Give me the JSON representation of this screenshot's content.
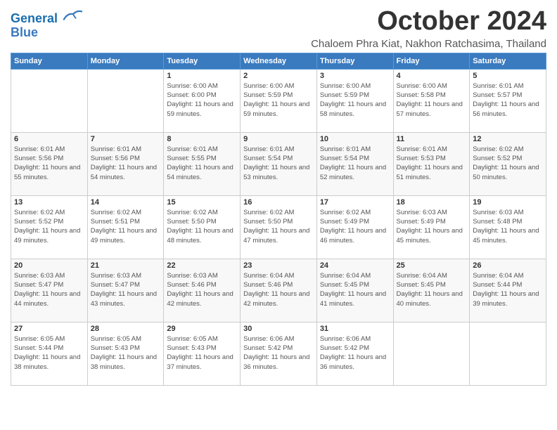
{
  "logo": {
    "line1": "General",
    "line2": "Blue"
  },
  "title": "October 2024",
  "subtitle": "Chaloem Phra Kiat, Nakhon Ratchasima, Thailand",
  "weekdays": [
    "Sunday",
    "Monday",
    "Tuesday",
    "Wednesday",
    "Thursday",
    "Friday",
    "Saturday"
  ],
  "weeks": [
    [
      {
        "day": "",
        "info": ""
      },
      {
        "day": "",
        "info": ""
      },
      {
        "day": "1",
        "info": "Sunrise: 6:00 AM\nSunset: 6:00 PM\nDaylight: 11 hours and 59 minutes."
      },
      {
        "day": "2",
        "info": "Sunrise: 6:00 AM\nSunset: 5:59 PM\nDaylight: 11 hours and 59 minutes."
      },
      {
        "day": "3",
        "info": "Sunrise: 6:00 AM\nSunset: 5:59 PM\nDaylight: 11 hours and 58 minutes."
      },
      {
        "day": "4",
        "info": "Sunrise: 6:00 AM\nSunset: 5:58 PM\nDaylight: 11 hours and 57 minutes."
      },
      {
        "day": "5",
        "info": "Sunrise: 6:01 AM\nSunset: 5:57 PM\nDaylight: 11 hours and 56 minutes."
      }
    ],
    [
      {
        "day": "6",
        "info": "Sunrise: 6:01 AM\nSunset: 5:56 PM\nDaylight: 11 hours and 55 minutes."
      },
      {
        "day": "7",
        "info": "Sunrise: 6:01 AM\nSunset: 5:56 PM\nDaylight: 11 hours and 54 minutes."
      },
      {
        "day": "8",
        "info": "Sunrise: 6:01 AM\nSunset: 5:55 PM\nDaylight: 11 hours and 54 minutes."
      },
      {
        "day": "9",
        "info": "Sunrise: 6:01 AM\nSunset: 5:54 PM\nDaylight: 11 hours and 53 minutes."
      },
      {
        "day": "10",
        "info": "Sunrise: 6:01 AM\nSunset: 5:54 PM\nDaylight: 11 hours and 52 minutes."
      },
      {
        "day": "11",
        "info": "Sunrise: 6:01 AM\nSunset: 5:53 PM\nDaylight: 11 hours and 51 minutes."
      },
      {
        "day": "12",
        "info": "Sunrise: 6:02 AM\nSunset: 5:52 PM\nDaylight: 11 hours and 50 minutes."
      }
    ],
    [
      {
        "day": "13",
        "info": "Sunrise: 6:02 AM\nSunset: 5:52 PM\nDaylight: 11 hours and 49 minutes."
      },
      {
        "day": "14",
        "info": "Sunrise: 6:02 AM\nSunset: 5:51 PM\nDaylight: 11 hours and 49 minutes."
      },
      {
        "day": "15",
        "info": "Sunrise: 6:02 AM\nSunset: 5:50 PM\nDaylight: 11 hours and 48 minutes."
      },
      {
        "day": "16",
        "info": "Sunrise: 6:02 AM\nSunset: 5:50 PM\nDaylight: 11 hours and 47 minutes."
      },
      {
        "day": "17",
        "info": "Sunrise: 6:02 AM\nSunset: 5:49 PM\nDaylight: 11 hours and 46 minutes."
      },
      {
        "day": "18",
        "info": "Sunrise: 6:03 AM\nSunset: 5:49 PM\nDaylight: 11 hours and 45 minutes."
      },
      {
        "day": "19",
        "info": "Sunrise: 6:03 AM\nSunset: 5:48 PM\nDaylight: 11 hours and 45 minutes."
      }
    ],
    [
      {
        "day": "20",
        "info": "Sunrise: 6:03 AM\nSunset: 5:47 PM\nDaylight: 11 hours and 44 minutes."
      },
      {
        "day": "21",
        "info": "Sunrise: 6:03 AM\nSunset: 5:47 PM\nDaylight: 11 hours and 43 minutes."
      },
      {
        "day": "22",
        "info": "Sunrise: 6:03 AM\nSunset: 5:46 PM\nDaylight: 11 hours and 42 minutes."
      },
      {
        "day": "23",
        "info": "Sunrise: 6:04 AM\nSunset: 5:46 PM\nDaylight: 11 hours and 42 minutes."
      },
      {
        "day": "24",
        "info": "Sunrise: 6:04 AM\nSunset: 5:45 PM\nDaylight: 11 hours and 41 minutes."
      },
      {
        "day": "25",
        "info": "Sunrise: 6:04 AM\nSunset: 5:45 PM\nDaylight: 11 hours and 40 minutes."
      },
      {
        "day": "26",
        "info": "Sunrise: 6:04 AM\nSunset: 5:44 PM\nDaylight: 11 hours and 39 minutes."
      }
    ],
    [
      {
        "day": "27",
        "info": "Sunrise: 6:05 AM\nSunset: 5:44 PM\nDaylight: 11 hours and 38 minutes."
      },
      {
        "day": "28",
        "info": "Sunrise: 6:05 AM\nSunset: 5:43 PM\nDaylight: 11 hours and 38 minutes."
      },
      {
        "day": "29",
        "info": "Sunrise: 6:05 AM\nSunset: 5:43 PM\nDaylight: 11 hours and 37 minutes."
      },
      {
        "day": "30",
        "info": "Sunrise: 6:06 AM\nSunset: 5:42 PM\nDaylight: 11 hours and 36 minutes."
      },
      {
        "day": "31",
        "info": "Sunrise: 6:06 AM\nSunset: 5:42 PM\nDaylight: 11 hours and 36 minutes."
      },
      {
        "day": "",
        "info": ""
      },
      {
        "day": "",
        "info": ""
      }
    ]
  ]
}
